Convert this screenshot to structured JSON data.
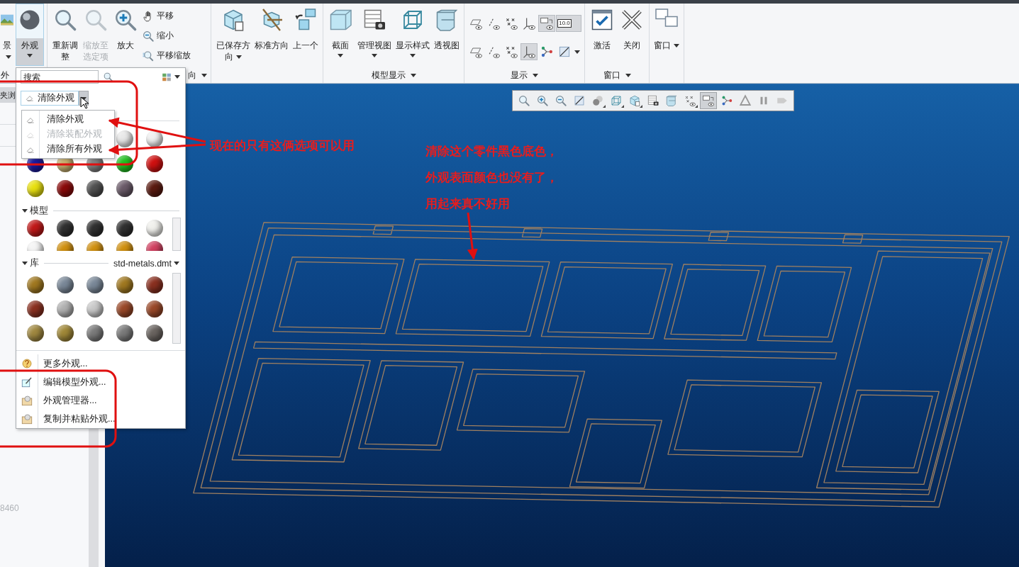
{
  "ribbon": {
    "groups": [
      {
        "label": "外",
        "label_menu": false,
        "buttons": [
          {
            "label": "景",
            "kind": "menubutton",
            "selected": false,
            "disabled": false
          },
          {
            "label": "外观",
            "kind": "dropdown",
            "selected": true,
            "disabled": false
          }
        ]
      },
      {
        "label": "向",
        "label_menu": true,
        "buttons": [
          {
            "label": "重新调整",
            "kind": "plain",
            "selected": false,
            "disabled": false
          },
          {
            "label": "缩放至选定项",
            "kind": "plain",
            "selected": false,
            "disabled": true
          },
          {
            "label": "放大",
            "kind": "plain",
            "selected": false,
            "disabled": false
          }
        ],
        "small_buttons": [
          {
            "label": "平移"
          },
          {
            "label": "缩小"
          },
          {
            "label": "平移缩放"
          }
        ]
      },
      {
        "buttons": [
          {
            "label": "已保存方向",
            "kind": "menubutton",
            "selected": false,
            "disabled": false
          },
          {
            "label": "标准方向",
            "kind": "plain",
            "selected": false,
            "disabled": false
          },
          {
            "label": "上一个",
            "kind": "plain",
            "selected": false,
            "disabled": false
          }
        ]
      },
      {
        "label": "模型显示",
        "label_menu": true,
        "buttons": [
          {
            "label": "截面",
            "kind": "dropdown",
            "selected": false,
            "disabled": false
          },
          {
            "label": "管理视图",
            "kind": "dropdown",
            "selected": false,
            "disabled": false
          },
          {
            "label": "显示样式",
            "kind": "dropdown",
            "selected": false,
            "disabled": false
          },
          {
            "label": "透视图",
            "kind": "plain",
            "selected": false,
            "disabled": false
          }
        ]
      },
      {
        "label": "显示",
        "label_menu": true,
        "toggles": [
          {
            "selected": false,
            "kind": "toggle"
          },
          {
            "selected": false,
            "kind": "toggle"
          },
          {
            "selected": false,
            "kind": "toggle"
          },
          {
            "selected": false,
            "kind": "toggle"
          },
          {
            "selected": true,
            "kind": "toggle"
          },
          {
            "selected": true,
            "kind": "toggle",
            "text": "10.0"
          },
          {
            "selected": false,
            "kind": "toggle"
          },
          {
            "selected": false,
            "kind": "toggle"
          },
          {
            "selected": false,
            "kind": "toggle"
          },
          {
            "selected": true,
            "kind": "toggle"
          },
          {
            "selected": false,
            "kind": "toggle"
          },
          {
            "selected": false,
            "kind": "split"
          }
        ]
      },
      {
        "label": "窗口",
        "label_menu": true,
        "buttons": [
          {
            "label": "激活",
            "kind": "plain",
            "selected": false,
            "disabled": false
          },
          {
            "label": "关闭",
            "kind": "plain",
            "selected": false,
            "disabled": false
          }
        ]
      },
      {
        "buttons": [
          {
            "label": "窗口",
            "kind": "menubutton",
            "selected": false,
            "disabled": false
          }
        ]
      }
    ]
  },
  "left_panel": {
    "tab_label": "夹浏",
    "footer_text": "8460"
  },
  "appearance_panel": {
    "search": {
      "placeholder": "搜索"
    },
    "clear_button": {
      "label": "清除外观"
    },
    "clear_menu": [
      {
        "label": "清除外观",
        "disabled": false
      },
      {
        "label": "清除装配外观",
        "disabled": true
      },
      {
        "label": "清除所有外观",
        "disabled": false
      }
    ],
    "recent": [
      {
        "color": "#e8e8e8"
      },
      {
        "color": "#f0f0f0"
      },
      {
        "color": "#1a1aa0"
      },
      {
        "color": "#c8b070"
      },
      {
        "color": "#808080"
      },
      {
        "color": "#20c020"
      },
      {
        "color": "#d01010"
      },
      {
        "color": "#e8e010"
      },
      {
        "color": "#8a0a0a"
      },
      {
        "color": "#505050"
      },
      {
        "color": "#6a5a68"
      },
      {
        "color": "#5a1a10"
      }
    ],
    "model_section": {
      "label": "模型",
      "swatches": [
        {
          "color": "#c01818"
        },
        {
          "color": "#303030"
        },
        {
          "color": "#303030"
        },
        {
          "color": "#303030"
        },
        {
          "color": "#f0f0ec"
        },
        {
          "color": "#f4f4f4"
        },
        {
          "color": "#d09010"
        },
        {
          "color": "#d09010"
        },
        {
          "color": "#d09010"
        },
        {
          "color": "#d04060"
        }
      ]
    },
    "library_section": {
      "label": "库",
      "file": "std-metals.dmt",
      "swatches": [
        {
          "color": "#a07820"
        },
        {
          "color": "#7a8898"
        },
        {
          "color": "#7a8898"
        },
        {
          "color": "#a07820"
        },
        {
          "color": "#8a3020"
        },
        {
          "color": "#8a3020"
        },
        {
          "color": "#b0b0b0"
        },
        {
          "color": "#c8c8c8"
        },
        {
          "color": "#9a4828"
        },
        {
          "color": "#9a4828"
        },
        {
          "color": "#a08840"
        },
        {
          "color": "#a08838"
        },
        {
          "color": "#7a7a7a"
        },
        {
          "color": "#7a7a7a"
        },
        {
          "color": "#6a6460"
        }
      ]
    },
    "actions": [
      {
        "label": "更多外观..."
      },
      {
        "label": "编辑模型外观..."
      },
      {
        "label": "外观管理器..."
      },
      {
        "label": "复制并粘贴外观..."
      }
    ]
  },
  "view_toolbar": [
    {
      "selected": false,
      "menu": false
    },
    {
      "selected": false,
      "menu": false
    },
    {
      "selected": false,
      "menu": false
    },
    {
      "selected": false,
      "menu": false
    },
    {
      "selected": false,
      "menu": true
    },
    {
      "selected": false,
      "menu": true
    },
    {
      "selected": false,
      "menu": true
    },
    {
      "selected": false,
      "menu": false
    },
    {
      "selected": false,
      "menu": false
    },
    {
      "selected": false,
      "menu": true
    },
    {
      "selected": true,
      "menu": false
    },
    {
      "selected": false,
      "menu": false
    },
    {
      "selected": false,
      "menu": false
    },
    {
      "selected": false,
      "menu": false
    },
    {
      "selected": false,
      "menu": false
    }
  ],
  "annotations": [
    {
      "text": "现在的只有这俩选项可以用"
    },
    {
      "text": "清除这个零件黑色底色，外观表面颜色也没有了，用起来真不好用"
    }
  ]
}
